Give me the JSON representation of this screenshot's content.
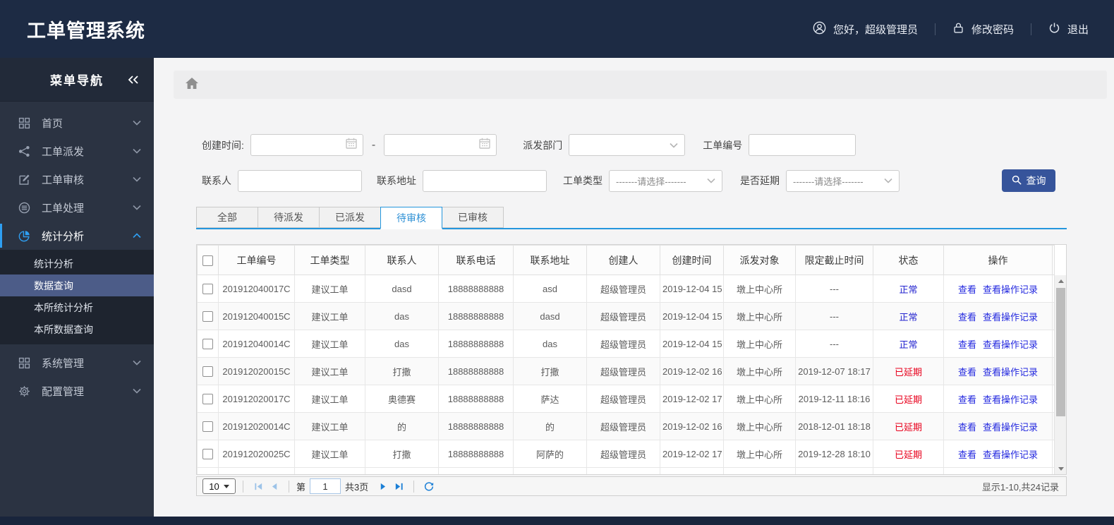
{
  "header": {
    "title": "工单管理系统",
    "greeting": "您好，超级管理员",
    "change_password": "修改密码",
    "logout": "退出"
  },
  "sidebar": {
    "title": "菜单导航",
    "collapse_icon": "double-chevron-left-icon",
    "items": [
      {
        "label": "首页",
        "icon": "grid"
      },
      {
        "label": "工单派发",
        "icon": "share"
      },
      {
        "label": "工单审核",
        "icon": "edit"
      },
      {
        "label": "工单处理",
        "icon": "layers"
      },
      {
        "label": "统计分析",
        "icon": "pie",
        "active": true,
        "expanded": true,
        "children": [
          {
            "label": "统计分析",
            "active": false
          },
          {
            "label": "数据查询",
            "active": true
          },
          {
            "label": "本所统计分析",
            "active": false
          },
          {
            "label": "本所数据查询",
            "active": false
          }
        ]
      },
      {
        "label": "系统管理",
        "icon": "grid"
      },
      {
        "label": "配置管理",
        "icon": "gear"
      }
    ]
  },
  "breadcrumb": {
    "icon": "home"
  },
  "search_form": {
    "create_time_label": "创建时间:",
    "range_separator": "-",
    "dispatch_dept_label": "派发部门",
    "order_no_label": "工单编号",
    "contact_label": "联系人",
    "address_label": "联系地址",
    "order_type_label": "工单类型",
    "order_type_value": "-------请选择-------",
    "delay_label": "是否延期",
    "delay_value": "-------请选择-------",
    "search_button": "查询"
  },
  "tabs": [
    {
      "label": "全部",
      "active": false
    },
    {
      "label": "待派发",
      "active": false
    },
    {
      "label": "已派发",
      "active": false
    },
    {
      "label": "待审核",
      "active": true
    },
    {
      "label": "已审核",
      "active": false
    }
  ],
  "table": {
    "columns": [
      "工单编号",
      "工单类型",
      "联系人",
      "联系电话",
      "联系地址",
      "创建人",
      "创建时间",
      "派发对象",
      "限定截止时间",
      "状态",
      "操作"
    ],
    "action_labels": [
      "查看",
      "查看操作记录"
    ],
    "rows": [
      {
        "order_no": "201912040017C",
        "type": "建议工单",
        "contact": "dasd",
        "phone": "18888888888",
        "address": "asd",
        "creator": "超级管理员",
        "created": "2019-12-04 15",
        "target": "墩上中心所",
        "deadline": "---",
        "status": "正常",
        "delayed": false
      },
      {
        "order_no": "201912040015C",
        "type": "建议工单",
        "contact": "das",
        "phone": "18888888888",
        "address": "dasd",
        "creator": "超级管理员",
        "created": "2019-12-04 15",
        "target": "墩上中心所",
        "deadline": "---",
        "status": "正常",
        "delayed": false
      },
      {
        "order_no": "201912040014C",
        "type": "建议工单",
        "contact": "das",
        "phone": "18888888888",
        "address": "das",
        "creator": "超级管理员",
        "created": "2019-12-04 15",
        "target": "墩上中心所",
        "deadline": "---",
        "status": "正常",
        "delayed": false
      },
      {
        "order_no": "201912020015C",
        "type": "建议工单",
        "contact": "打撒",
        "phone": "18888888888",
        "address": "打撒",
        "creator": "超级管理员",
        "created": "2019-12-02 16",
        "target": "墩上中心所",
        "deadline": "2019-12-07 18:17",
        "status": "已延期",
        "delayed": true
      },
      {
        "order_no": "201912020017C",
        "type": "建议工单",
        "contact": "奥德赛",
        "phone": "18888888888",
        "address": "萨达",
        "creator": "超级管理员",
        "created": "2019-12-02 17",
        "target": "墩上中心所",
        "deadline": "2019-12-11 18:16",
        "status": "已延期",
        "delayed": true
      },
      {
        "order_no": "201912020014C",
        "type": "建议工单",
        "contact": "的",
        "phone": "18888888888",
        "address": "的",
        "creator": "超级管理员",
        "created": "2019-12-02 16",
        "target": "墩上中心所",
        "deadline": "2018-12-01 18:18",
        "status": "已延期",
        "delayed": true
      },
      {
        "order_no": "201912020025C",
        "type": "建议工单",
        "contact": "打撒",
        "phone": "18888888888",
        "address": "阿萨的",
        "creator": "超级管理员",
        "created": "2019-12-02 17",
        "target": "墩上中心所",
        "deadline": "2019-12-28 18:10",
        "status": "已延期",
        "delayed": true
      }
    ],
    "partial_row_visible": true
  },
  "pagination": {
    "page_size": "10",
    "page_prefix": "第",
    "current_page": "1",
    "total_pages": "共3页",
    "summary": "显示1-10,共24记录"
  },
  "colors": {
    "header_bg": "#1d2b44",
    "sidebar_bg": "#2b3342",
    "accent_blue": "#2e9ff2",
    "tab_active_blue": "#2496dd",
    "active_submenu_bg": "#4c5c88",
    "search_button_bg": "#36549b",
    "status_normal": "#2323cf",
    "status_delayed": "#e8001c",
    "link_color": "#2328df"
  }
}
